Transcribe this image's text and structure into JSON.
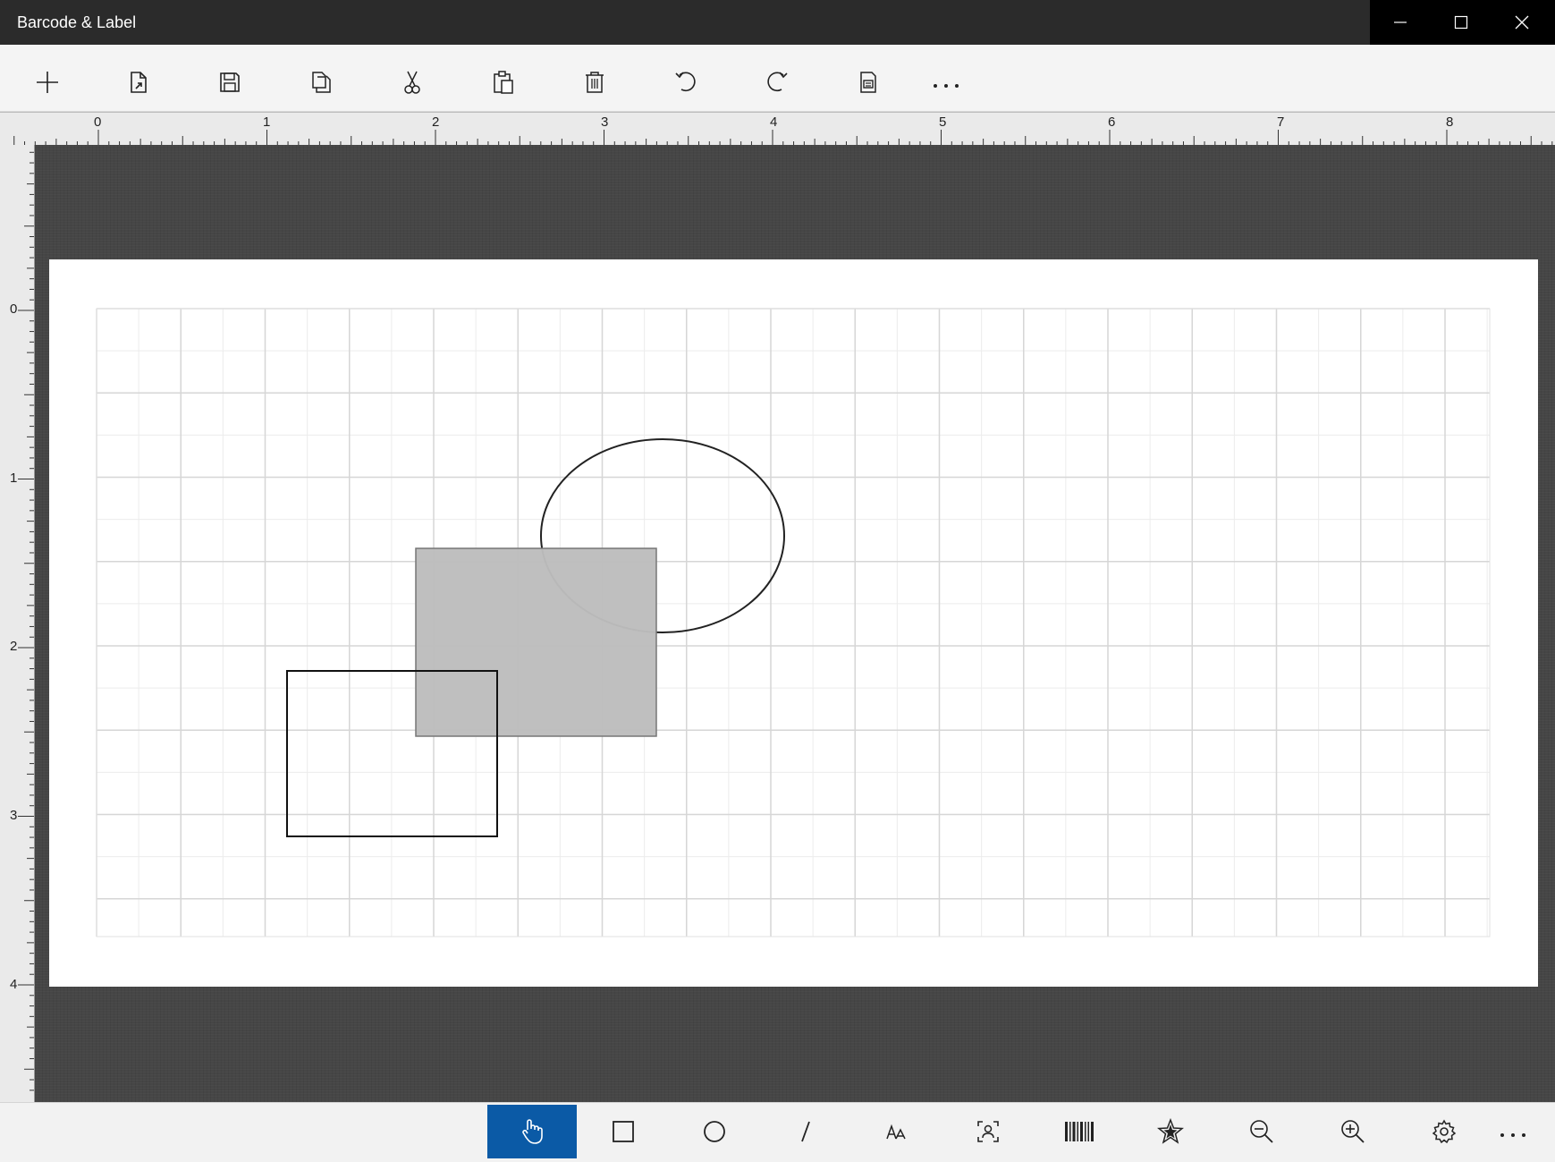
{
  "window": {
    "title": "Barcode & Label",
    "controls": [
      "minimize-icon",
      "maximize-icon",
      "close-icon"
    ]
  },
  "toolbar": {
    "items": [
      {
        "name": "new-button",
        "icon": "plus-icon"
      },
      {
        "name": "open-button",
        "icon": "open-file-icon"
      },
      {
        "name": "save-button",
        "icon": "save-icon"
      },
      {
        "name": "copy-button",
        "icon": "copy-icon"
      },
      {
        "name": "cut-button",
        "icon": "scissors-icon"
      },
      {
        "name": "paste-button",
        "icon": "clipboard-icon"
      },
      {
        "name": "delete-button",
        "icon": "trash-icon"
      },
      {
        "name": "undo-button",
        "icon": "undo-icon"
      },
      {
        "name": "redo-button",
        "icon": "redo-icon"
      },
      {
        "name": "print-button",
        "icon": "print-icon"
      },
      {
        "name": "more-button",
        "icon": "ellipsis-icon"
      }
    ]
  },
  "rulers": {
    "top_labels": [
      "0",
      "1",
      "2",
      "3",
      "4",
      "5",
      "6",
      "7",
      "8"
    ],
    "left_labels": [
      "0",
      "1",
      "2",
      "3",
      "4"
    ]
  },
  "canvas": {
    "grid": true,
    "shapes": [
      {
        "type": "ellipse",
        "fill": "none",
        "stroke": "#222222"
      },
      {
        "type": "rectangle",
        "fill": "#bdbdbd",
        "stroke": "#777777"
      },
      {
        "type": "rectangle",
        "fill": "none",
        "stroke": "#111111"
      }
    ]
  },
  "bottom_toolbar": {
    "active_tool": "select-tool",
    "accent_color": "#0b5aa6",
    "items": [
      {
        "name": "select-tool",
        "icon": "hand-pointer-icon"
      },
      {
        "name": "rectangle-tool",
        "icon": "square-icon"
      },
      {
        "name": "ellipse-tool",
        "icon": "circle-icon"
      },
      {
        "name": "line-tool",
        "icon": "line-icon"
      },
      {
        "name": "text-tool",
        "icon": "text-icon"
      },
      {
        "name": "image-tool",
        "icon": "image-icon"
      },
      {
        "name": "barcode-tool",
        "icon": "barcode-icon"
      },
      {
        "name": "symbol-tool",
        "icon": "star-icon"
      },
      {
        "name": "zoom-out-button",
        "icon": "zoom-out-icon"
      },
      {
        "name": "zoom-in-button",
        "icon": "zoom-in-icon"
      },
      {
        "name": "settings-button",
        "icon": "gear-icon"
      },
      {
        "name": "more-button",
        "icon": "ellipsis-icon"
      }
    ]
  }
}
